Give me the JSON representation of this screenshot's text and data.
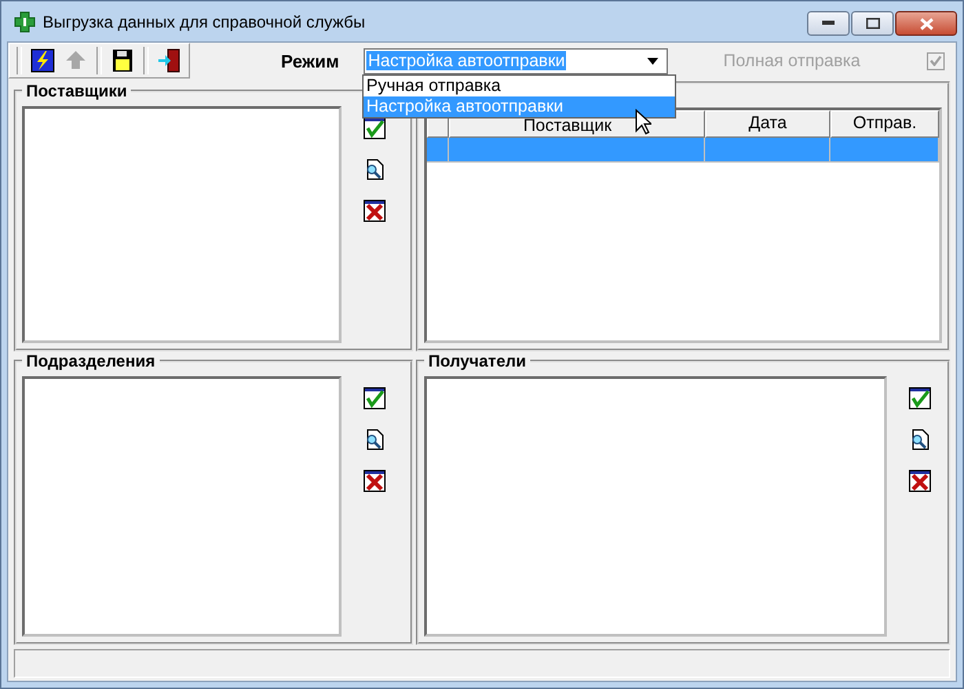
{
  "window": {
    "title": "Выгрузка данных для справочной службы"
  },
  "toolbar": {
    "buttons": [
      {
        "kind": "run",
        "disabled": false
      },
      {
        "kind": "back",
        "disabled": true
      },
      {
        "kind": "save",
        "disabled": false
      },
      {
        "kind": "exit",
        "disabled": false
      }
    ]
  },
  "mode": {
    "label": "Режим",
    "value": "Настройка автоотправки",
    "options": [
      {
        "label": "Ручная отправка",
        "selected": false
      },
      {
        "label": "Настройка автоотправки",
        "selected": true
      }
    ]
  },
  "full_send": {
    "label": "Полная отправка",
    "checked": true,
    "disabled": true
  },
  "suppliers": {
    "title": "Поставщики"
  },
  "sends": {
    "columns": [
      "",
      "Поставщик",
      "Дата",
      "Отправ."
    ],
    "rows": [
      {
        "selected": true
      }
    ]
  },
  "departments": {
    "title": "Подразделения"
  },
  "recipients": {
    "title": "Получатели"
  }
}
